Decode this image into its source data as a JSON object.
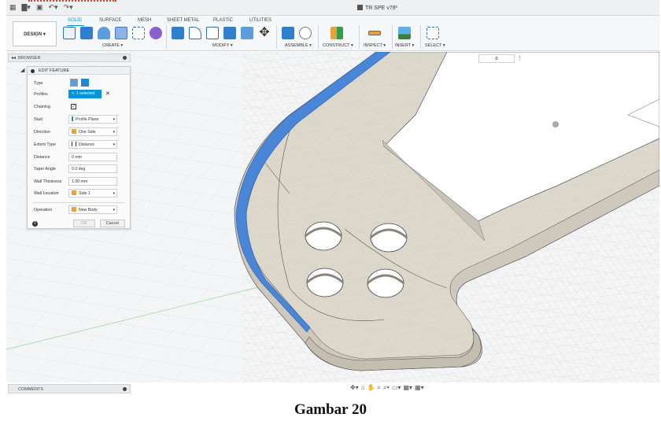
{
  "window": {
    "title": "TR SPE v79*"
  },
  "ribbon": {
    "workspace_button": "DESIGN ▾",
    "tabs": [
      "SOLID",
      "SURFACE",
      "MESH",
      "SHEET METAL",
      "PLASTIC",
      "UTILITIES"
    ],
    "active_tab": "SOLID",
    "groups": [
      "CREATE ▾",
      "MODIFY ▾",
      "ASSEMBLE ▾",
      "CONSTRUCT ▾",
      "INSPECT ▾",
      "INSERT ▾",
      "SELECT ▾"
    ]
  },
  "browser": {
    "label": "BROWSER"
  },
  "edit_feature": {
    "title": "EDIT FEATURE",
    "rows": {
      "type": "Type",
      "profiles": "Profiles",
      "profiles_value": "1 selected",
      "chaining": "Chaining",
      "start": "Start",
      "start_value": "Profile Plane",
      "direction": "Direction",
      "direction_value": "One Side",
      "extent_type": "Extent Type",
      "extent_type_value": "Distance",
      "distance": "Distance",
      "distance_value": "0 mm",
      "taper_angle": "Taper Angle",
      "taper_angle_value": "0.0 deg",
      "wall_thickness": "Wall Thickness",
      "wall_thickness_value": "1.00 mm",
      "wall_location": "Wall Location",
      "wall_location_value": "Side 1",
      "operation": "Operation",
      "operation_value": "New Body"
    },
    "ok_label": "OK",
    "cancel_label": "Cancel"
  },
  "viewport": {
    "zoom_value": "0"
  },
  "comments": {
    "label": "COMMENTS"
  },
  "caption": "Gambar 20",
  "colors": {
    "accent": "#0696d7",
    "selected_face": "#4a86d8",
    "body": "#d6d1c6"
  }
}
